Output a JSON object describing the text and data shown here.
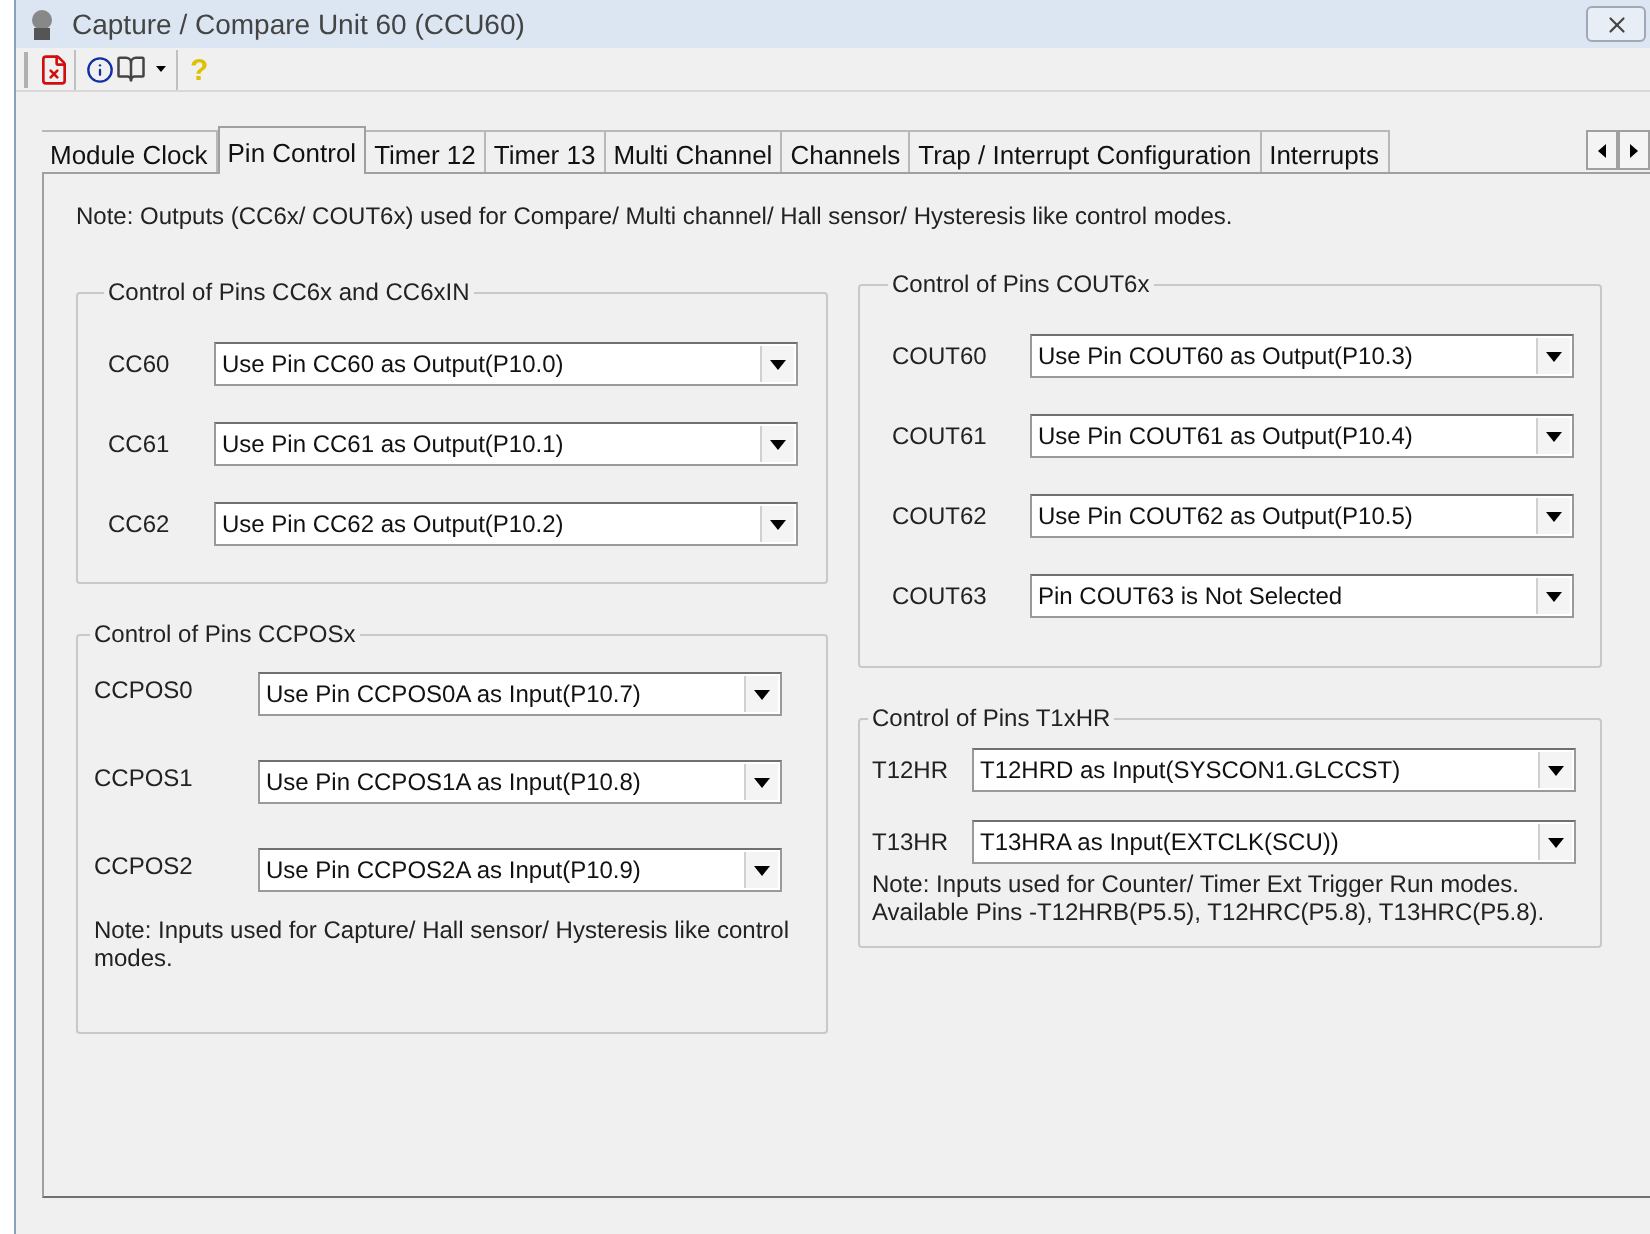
{
  "window": {
    "title": "Capture / Compare Unit 60 (CCU60)"
  },
  "toolbar": {
    "help_label": "?"
  },
  "tabs": [
    {
      "label": "Module Clock",
      "selected": false
    },
    {
      "label": "Pin Control",
      "selected": true
    },
    {
      "label": "Timer 12",
      "selected": false
    },
    {
      "label": "Timer 13",
      "selected": false
    },
    {
      "label": "Multi Channel",
      "selected": false
    },
    {
      "label": "Channels",
      "selected": false
    },
    {
      "label": "Trap / Interrupt Configuration",
      "selected": false
    },
    {
      "label": "Interrupts",
      "selected": false
    }
  ],
  "note": "Note: Outputs (CC6x/ COUT6x) used for Compare/ Multi channel/ Hall sensor/ Hysteresis like control modes.",
  "left_column": [
    {
      "title": "Control of Pins CC6x and CC6xIN",
      "rows": [
        {
          "label": "CC60",
          "value": "Use Pin CC60 as Output(P10.0)"
        },
        {
          "label": "CC61",
          "value": "Use Pin CC61 as Output(P10.1)"
        },
        {
          "label": "CC62",
          "value": "Use Pin CC62 as Output(P10.2)"
        }
      ]
    },
    {
      "title": "Control of Pins CCPOSx",
      "rows": [
        {
          "label": "CCPOS0",
          "value": "Use Pin CCPOS0A as Input(P10.7)"
        },
        {
          "label": "CCPOS1",
          "value": "Use Pin CCPOS1A as Input(P10.8)"
        },
        {
          "label": "CCPOS2",
          "value": "Use Pin CCPOS2A as Input(P10.9)"
        }
      ],
      "note": "Note: Inputs used for Capture/ Hall sensor/ Hysteresis like control modes."
    }
  ],
  "right_column": [
    {
      "title": "Control of Pins COUT6x",
      "rows": [
        {
          "label": "COUT60",
          "value": "Use Pin COUT60 as Output(P10.3)"
        },
        {
          "label": "COUT61",
          "value": "Use Pin COUT61 as Output(P10.4)"
        },
        {
          "label": "COUT62",
          "value": "Use Pin COUT62 as Output(P10.5)"
        },
        {
          "label": "COUT63",
          "value": "Pin COUT63 is Not Selected"
        }
      ]
    },
    {
      "title": "Control of Pins T1xHR",
      "rows": [
        {
          "label": "T12HR",
          "value": "T12HRD as Input(SYSCON1.GLCCST)"
        },
        {
          "label": "T13HR",
          "value": "T13HRA as Input(EXTCLK(SCU))"
        }
      ],
      "note": "Note: Inputs used for Counter/ Timer Ext Trigger Run modes. Available Pins -T12HRB(P5.5), T12HRC(P5.8), T13HRC(P5.8)."
    }
  ]
}
